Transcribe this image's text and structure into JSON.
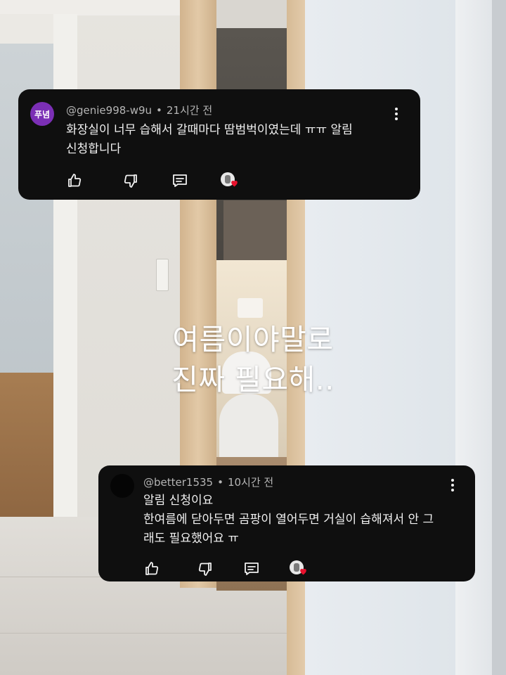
{
  "overlay": {
    "line1": "여름이야말로",
    "line2": "진짜 필요해.."
  },
  "comments": [
    {
      "avatar_text": "푸념",
      "avatar_color": "#7b2fb5",
      "author": "@genie998-w9u",
      "time": "21시간 전",
      "lines": [
        "화장실이 너무 습해서 갈때마다 땀범벅이였는데 ㅠㅠ 알림",
        "신청합니다"
      ],
      "icons": [
        "thumbs-up-icon",
        "thumbs-down-icon",
        "reply-icon",
        "creator-heart-icon"
      ]
    },
    {
      "avatar_text": "",
      "avatar_color": "#050505",
      "author": "@better1535",
      "time": "10시간 전",
      "lines": [
        "알림 신청이요",
        "한여름에 닫아두면 곰팡이 열어두면 거실이 습해져서 안 그",
        "래도 필요했어요 ㅠ"
      ],
      "icons": [
        "thumbs-up-icon",
        "thumbs-down-icon",
        "reply-icon",
        "creator-heart-icon"
      ]
    }
  ],
  "colors": {
    "card_bg": "#0f0f0f",
    "meta_text": "#b5b5b5",
    "heart": "#e8112d"
  }
}
